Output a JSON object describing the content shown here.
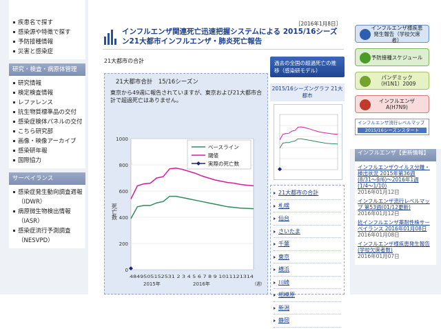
{
  "left": {
    "top_items": [
      "疾患名で探す",
      "感染源や特徴で探す",
      "予防接種情報",
      "災害と感染症"
    ],
    "section1": "研究・検査・病原体管理",
    "section1_items": [
      "研究情報",
      "検定検査情報",
      "レファレンス",
      "抗生物質標準品の交付",
      "感染症検体パネルの交付",
      "こちら研究部",
      "画像・映像アーカイブ",
      "感染研年報",
      "国際協力"
    ],
    "section2": "サーベイランス",
    "section2_items": [
      "感染症発生動向調査週報（IDWR）",
      "病原微生物検出情報（IASR）",
      "感染症流行予測調査（NESVPD）"
    ]
  },
  "center": {
    "date": "［2016年1月8日］",
    "title": "インフルエンザ関連死亡迅速把握システムによる 2015/16シーズン21大都市インフルエンザ・肺炎死亡報告",
    "subtitle": "21大都市の合計",
    "blue_button": "過去の全国の超過死亡の推移（感染研モデル）",
    "thumb_header": "2015/16シーズングラフ 21大都市",
    "chart_title": "21大都市合計　15/16シーズン",
    "chart_desc": "東京から49週に報告されていますが、東京および21大都市合計で超過死亡はありません。",
    "cities": [
      "21大都市の合計",
      "札幌",
      "仙台",
      "さいたま",
      "千葉",
      "東京",
      "横浜",
      "川崎",
      "相模原",
      "新潟",
      "静岡"
    ]
  },
  "chart_data": {
    "type": "line",
    "title": "21大都市合計　15/16シーズン",
    "ylabel": "死亡数",
    "ylim": [
      0,
      1000
    ],
    "yticks": [
      0,
      200,
      400,
      600,
      800,
      1000
    ],
    "x_label_text": "4849505152531 2 3 4 5 6 7 8 9 1011121314",
    "x_year_labels": [
      "2015年",
      "2016年"
    ],
    "x_unit": "（週）",
    "x": [
      48,
      49,
      50,
      51,
      52,
      53,
      1,
      2,
      3,
      4,
      5,
      6,
      7,
      8,
      9,
      10,
      11,
      12,
      13,
      14
    ],
    "series": [
      {
        "name": "ベースライン",
        "color": "#2e8b57",
        "values": [
          390,
          480,
          490,
          490,
          510,
          520,
          560,
          560,
          550,
          540,
          530,
          520,
          510,
          500,
          490,
          480,
          475,
          470,
          468,
          465
        ]
      },
      {
        "name": "閾値",
        "color": "#d81b9a",
        "values": [
          540,
          640,
          655,
          660,
          700,
          710,
          770,
          775,
          765,
          750,
          735,
          715,
          700,
          685,
          675,
          665,
          660,
          650,
          645,
          640
        ]
      },
      {
        "name": "実際の死亡数",
        "color": "#1a237e",
        "values": [
          10,
          null,
          null,
          null,
          null,
          null,
          null,
          null,
          null,
          null,
          null,
          null,
          null,
          null,
          null,
          null,
          null,
          null,
          null,
          null
        ]
      }
    ]
  },
  "right": {
    "buttons": [
      {
        "label": "インフルエンザ様疾患発生報告（学校欠席者）",
        "bg": "#d6e4f5",
        "border": "#6b8cc6",
        "icon": "#2d5fae"
      },
      {
        "label": "予防接種スケジュール",
        "bg": "#dcefd0",
        "border": "#7bb35c",
        "icon": "#4c9a2a"
      },
      {
        "label": "パンデミック（H1N1）2009",
        "bg": "#e7f2c4",
        "border": "#9fc25c",
        "icon": "#73a32a"
      },
      {
        "label": "インフルエンザA(H7N9)",
        "bg": "#f8dcdc",
        "border": "#d27a7a",
        "icon": "#c0392b"
      }
    ],
    "start_box_text": "インフルエンザ流行レベルマップ",
    "start_box_bar": "2015/16シーズンスタート",
    "news_header": "インフルエンザ【更新情報】",
    "news": [
      {
        "title": "インフルエンザウイルス分離・検出状況 2015年第36週(8/31〜9/6)〜2016年1週(1/4〜1/10)",
        "date": "2016年01月12日"
      },
      {
        "title": "インフルエンザ流行レベルマップ 第53週(01/12更新)",
        "date": "2016年01月12日"
      },
      {
        "title": "抗インフルエンザ薬耐性株サーベイランス 2016年01月08日",
        "date": "2016年01月08日"
      },
      {
        "title": "インフルエンザ様疾患発生報告(学校欠席者数)",
        "date": "2016年01月07日"
      }
    ]
  }
}
